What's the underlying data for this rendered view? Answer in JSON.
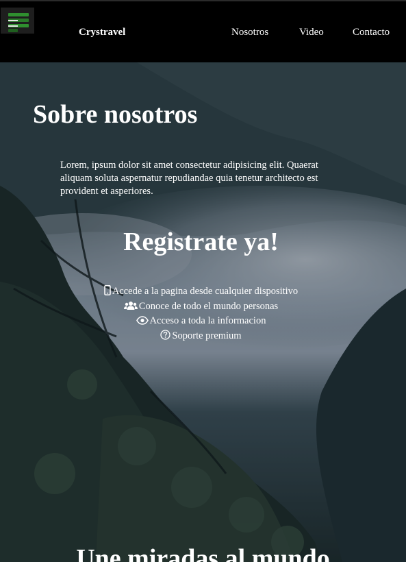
{
  "navbar": {
    "brand": "Crystravel",
    "links": [
      "Nosotros",
      "Video",
      "Contacto"
    ],
    "logo_icon": "hamburger-logo-icon",
    "logo_color": "#2f8f2f"
  },
  "about": {
    "title": "Sobre nosotros",
    "text": "Lorem, ipsum dolor sit amet consectetur adipisicing elit. Quaerat aliquam soluta aspernatur repudiandae quia tenetur architecto est provident et asperiores."
  },
  "register": {
    "title": "Registrate ya!",
    "features": [
      {
        "icon": "mobile-phone-icon",
        "label": "Accede a la pagina desde cualquier dispositivo"
      },
      {
        "icon": "users-icon",
        "label": "Conoce de todo el mundo personas"
      },
      {
        "icon": "eye-icon",
        "label": "Acceso a toda la informacion"
      },
      {
        "icon": "question-circle-icon",
        "label": "Soporte premium"
      }
    ]
  },
  "next_section": {
    "title": "Une miradas al mundo"
  }
}
